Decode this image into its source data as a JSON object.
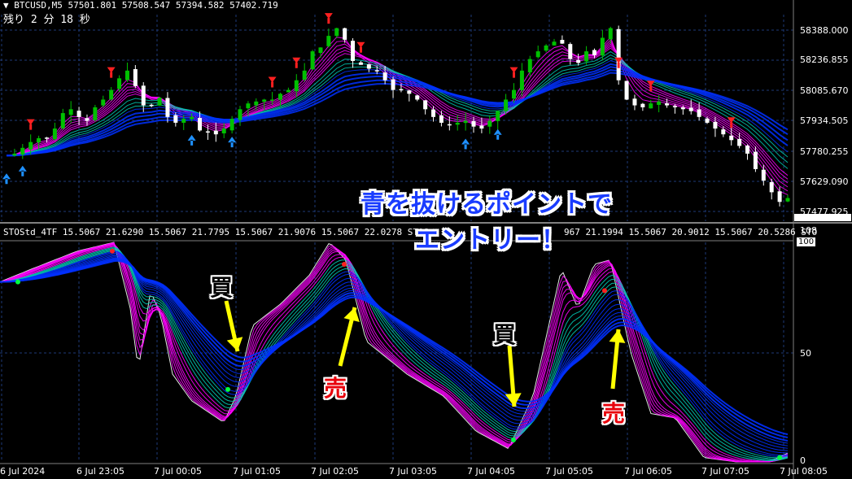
{
  "main_chart": {
    "header": "▼ BTCUSD,M5  57501.801 57508.547 57394.582 57402.719",
    "countdown": "残り 2 分 18 秒",
    "price_ticks": [
      "58388.000",
      "58236.855",
      "58085.670",
      "57934.505",
      "57780.255",
      "57629.090",
      "57477.925"
    ],
    "price_range": [
      57420,
      58490
    ]
  },
  "indicator": {
    "header": "STOStd_4TF 15.5067 21.6290 15.5067 21.7795 15.5067 21.9076 15.5067 22.0278  STOS",
    "header_tail": "967 21.1994 15.5067 20.9012 15.5067 20.5286  STO",
    "top_value": "108",
    "level_100": "100",
    "level_50": "50",
    "level_0": "0"
  },
  "time_axis": [
    "6 Jul 2024",
    "6 Jul 23:05",
    "7 Jul 00:05",
    "7 Jul 01:05",
    "7 Jul 02:05",
    "7 Jul 03:05",
    "7 Jul 04:05",
    "7 Jul 05:05",
    "7 Jul 06:05",
    "7 Jul 07:05",
    "7 Jul 08:05"
  ],
  "annotations": {
    "callout_line1": "青を抜けるポイントで",
    "callout_line2": "エントリー！",
    "buy_label": "買",
    "sell_label": "売"
  },
  "colors": {
    "bull_candle": "#00c000",
    "bear_candle": "#ffffff",
    "ema_fast": "#ff00ff",
    "ema_mid": "#00c8b4",
    "ema_slow": "#0030ff",
    "grid": "#1e3a78",
    "sell_arrow": "#ff2020",
    "buy_arrow": "#1e90ff",
    "callout_text": "#1a3cff",
    "arrow_yellow": "#ffff00"
  },
  "chart_data": {
    "type": "candlestick",
    "symbol": "BTCUSD",
    "timeframe": "M5",
    "x_ticks": [
      "6 Jul 2024",
      "6 Jul 23:05",
      "7 Jul 00:05",
      "7 Jul 01:05",
      "7 Jul 02:05",
      "7 Jul 03:05",
      "7 Jul 04:05",
      "7 Jul 05:05",
      "7 Jul 06:05",
      "7 Jul 07:05",
      "7 Jul 08:05"
    ],
    "y_ticks": [
      58388.0,
      58236.855,
      58085.67,
      57934.505,
      57780.255,
      57629.09,
      57477.925
    ],
    "close_path": [
      57760,
      57770,
      57800,
      57830,
      57850,
      57850,
      57900,
      57980,
      58000,
      57960,
      57940,
      58010,
      58050,
      58100,
      58160,
      58200,
      58120,
      58020,
      58020,
      58060,
      57960,
      57930,
      57950,
      57960,
      57890,
      57880,
      57870,
      57900,
      57950,
      58000,
      58030,
      58040,
      58050,
      58050,
      58080,
      58100,
      58150,
      58200,
      58300,
      58320,
      58380,
      58420,
      58360,
      58250,
      58230,
      58210,
      58200,
      58150,
      58100,
      58100,
      58080,
      58050,
      58000,
      57960,
      57930,
      57920,
      57930,
      57940,
      57910,
      57900,
      57940,
      57990,
      58050,
      58100,
      58200,
      58260,
      58300,
      58330,
      58350,
      58340,
      58260,
      58240,
      58300,
      58280,
      58370,
      58420,
      58150,
      58050,
      58020,
      58010,
      58030,
      58040,
      58020,
      58010,
      58000,
      57990,
      57960,
      57930,
      57900,
      57870,
      57840,
      57810,
      57770,
      57690,
      57630,
      57570,
      57520,
      57540
    ],
    "current_close": 57402.719,
    "indicator": {
      "name": "STOStd_4TF",
      "values": [
        15.5067,
        21.629,
        15.5067,
        21.7795,
        15.5067,
        21.9076,
        15.5067,
        22.0278
      ],
      "levels": [
        0,
        50,
        100
      ]
    },
    "signals": [
      {
        "label": "買",
        "time": "7 Jul 01:05"
      },
      {
        "label": "売",
        "time": "7 Jul 02:05"
      },
      {
        "label": "買",
        "time": "7 Jul 04:05"
      },
      {
        "label": "売",
        "time": "7 Jul 06:05"
      }
    ]
  }
}
